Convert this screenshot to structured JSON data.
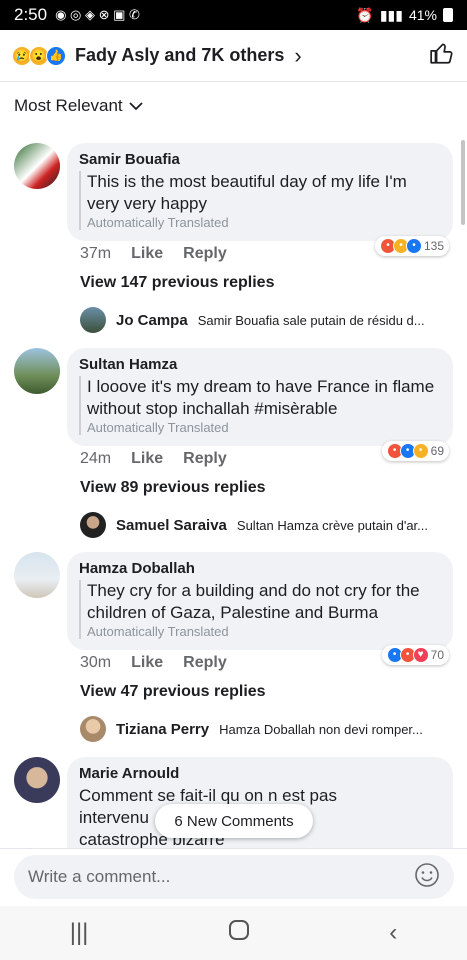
{
  "status": {
    "time": "2:50",
    "battery": "41%"
  },
  "header": {
    "title": "Fady Asly and 7K others"
  },
  "sort": {
    "label": "Most Relevant"
  },
  "comments": [
    {
      "author": "Samir Bouafia",
      "text": "This is the most beautiful day of my life I'm very very happy",
      "translated": "Automatically Translated",
      "time": "37m",
      "like": "Like",
      "reply": "Reply",
      "reaction_count": "135",
      "view_previous": "View 147 previous replies",
      "reply_author": "Jo Campa",
      "reply_text": "Samir Bouafia sale putain de résidu d..."
    },
    {
      "author": "Sultan Hamza",
      "text": "I looove it's my dream to have France in flame without stop inchallah #misèrable",
      "translated": "Automatically Translated",
      "time": "24m",
      "like": "Like",
      "reply": "Reply",
      "reaction_count": "69",
      "view_previous": "View 89 previous replies",
      "reply_author": "Samuel Saraiva",
      "reply_text": "Sultan Hamza crève putain d'ar..."
    },
    {
      "author": "Hamza Doballah",
      "text": "They cry for a building and do not cry for the children of Gaza, Palestine and Burma",
      "translated": "Automatically Translated",
      "time": "30m",
      "like": "Like",
      "reply": "Reply",
      "reaction_count": "70",
      "view_previous": "View 47 previous replies",
      "reply_author": "Tiziana Perry",
      "reply_text": "Hamza Doballah non devi romper..."
    },
    {
      "author": "Marie Arnould",
      "text_line1": "Comment se fait-il qu on n est pas",
      "text_line2": "intervenu",
      "text_line3": "catastrophe bizarre"
    }
  ],
  "new_comments": "6 New Comments",
  "composer": {
    "placeholder": "Write a comment..."
  },
  "colors": {
    "like_blue": "#1877f2",
    "angry_orange": "#f0553b",
    "haha_yellow": "#f7b125",
    "love_red": "#f33e58"
  }
}
